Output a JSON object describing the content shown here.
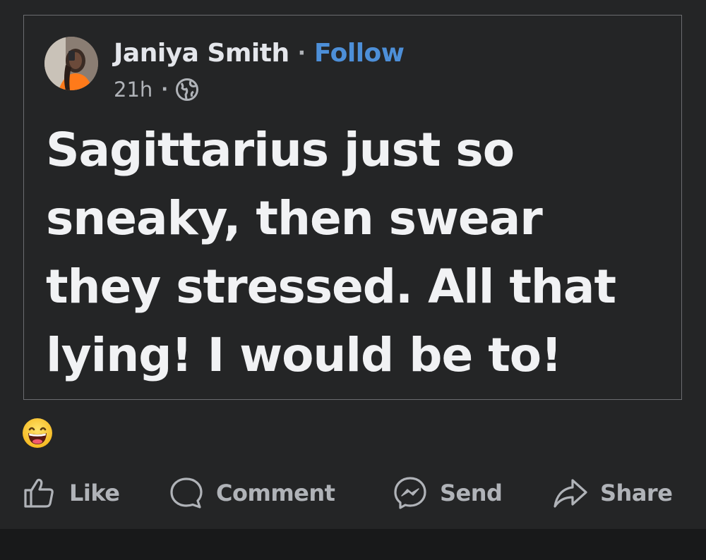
{
  "post": {
    "author": "Janiya Smith",
    "separator": "·",
    "follow_label": "Follow",
    "timestamp": "21h",
    "meta_separator": "·",
    "audience_icon": "globe-icon",
    "text": "Sagittarius just so sneaky, then swear they stressed. All that lying! I would be to!"
  },
  "reactions": {
    "emoji_icon": "grinning-face-emoji"
  },
  "actions": {
    "like_label": "Like",
    "comment_label": "Comment",
    "send_label": "Send",
    "share_label": "Share"
  },
  "colors": {
    "background": "#242526",
    "follow": "#4d8fd8",
    "text_primary": "#e4e6eb",
    "text_secondary": "#b0b3b8"
  }
}
